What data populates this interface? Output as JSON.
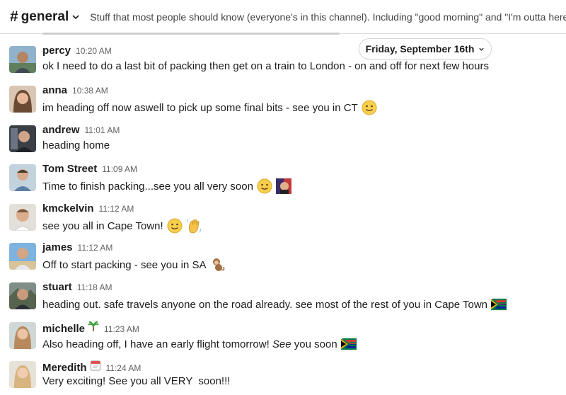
{
  "header": {
    "hash": "#",
    "channel": "general",
    "topic": "Stuff that most people should know (everyone's in this channel). Including \"good morning\" and \"I'm outta here\""
  },
  "date_divider": "Friday, September 16th",
  "messages": [
    {
      "user": "percy",
      "time": "10:20 AM",
      "text": "ok I need to do a last bit of packing then get on a train to London - on and off for next few hours",
      "avatar_color": "#7a8fa0"
    },
    {
      "user": "anna",
      "time": "10:38 AM",
      "text": "im heading off now aswell to pick up some final bits - see you in CT",
      "avatar_color": "#b98a6d"
    },
    {
      "user": "andrew",
      "time": "11:01 AM",
      "text": "heading home",
      "avatar_color": "#4a4f57"
    },
    {
      "user": "Tom Street",
      "time": "11:09 AM",
      "text": "Time to finish packing...see you all very soon",
      "avatar_color": "#8aa1b4"
    },
    {
      "user": "kmckelvin",
      "time": "11:12 AM",
      "text": "see you all in Cape Town!",
      "avatar_color": "#9c7d66"
    },
    {
      "user": "james",
      "time": "11:12 AM",
      "text": "Off to start packing - see you in SA",
      "avatar_color": "#6f9cc4"
    },
    {
      "user": "stuart",
      "time": "11:18 AM",
      "text": "heading out. safe travels anyone on the road already. see most of the rest of you in Cape Town",
      "avatar_color": "#5b6b5a"
    },
    {
      "user": "michelle",
      "time": "11:23 AM",
      "text_before": "Also heading off, I have an early flight tomorrow! ",
      "text_italic": "See",
      "text_after": " you soon",
      "avatar_color": "#c9a27e"
    },
    {
      "user": "Meredith",
      "time": "11:24 AM",
      "text": "Very exciting! See you all VERY  soon!!!",
      "avatar_color": "#d9b98f"
    }
  ],
  "icons": {
    "chevron": "chevron-down-icon",
    "smile": "slightly-smiling-face-emoji",
    "wave": "waving-hand-emoji",
    "monkey": "monkey-emoji",
    "flag_za": "south-africa-flag-emoji",
    "palm": "palm-tree-emoji",
    "calendar": "calendar-emoji",
    "custom": "custom-face-emoji"
  }
}
